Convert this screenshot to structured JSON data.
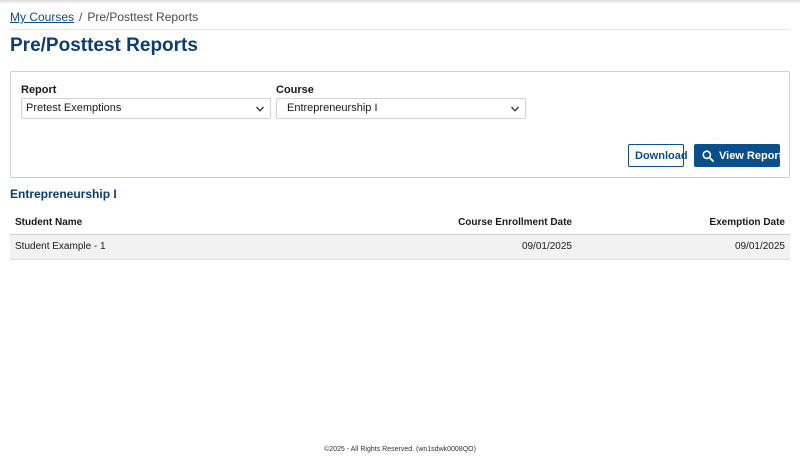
{
  "breadcrumb": {
    "home_label": "My Courses",
    "separator": "/",
    "current_label": "Pre/Posttest Reports"
  },
  "page": {
    "title": "Pre/Posttest Reports"
  },
  "filters": {
    "report": {
      "label": "Report",
      "value": "Pretest Exemptions"
    },
    "course": {
      "label": "Course",
      "value": "Entrepreneurship I"
    },
    "download_label": "Download",
    "view_report_label": "View Report",
    "icons": {
      "dropdown": "chevron-down-icon",
      "view_report": "search-icon"
    }
  },
  "report": {
    "section_title": "Entrepreneurship I",
    "columns": {
      "student_name": "Student Name",
      "enrollment_date": "Course Enrollment Date",
      "exemption_date": "Exemption Date"
    },
    "rows": [
      {
        "student_name": "Student Example - 1",
        "enrollment_date": "09/01/2025",
        "exemption_date": "09/01/2025"
      }
    ]
  },
  "footer": {
    "text": "©2025 - All Rights Reserved. (wn1sdwk0008QO)"
  },
  "colors": {
    "brand_blue": "#0b4f8a",
    "title_blue": "#0b3d6e",
    "row_background": "#f2f2f2"
  }
}
